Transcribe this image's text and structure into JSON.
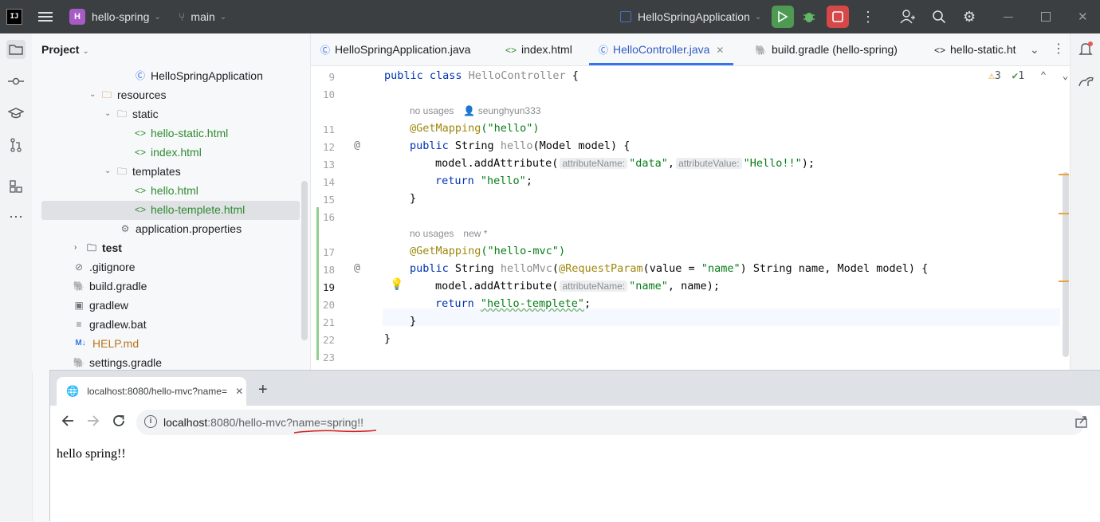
{
  "titlebar": {
    "logo": "IJ",
    "project_badge": "H",
    "project_name": "hello-spring",
    "branch": "main",
    "run_config": "HelloSpringApplication"
  },
  "project_panel": {
    "title": "Project",
    "tree": [
      {
        "label": "HelloSpringApplication",
        "icon": "class-icon",
        "color": "default"
      },
      {
        "label": "resources",
        "icon": "folder-icon",
        "color": "default"
      },
      {
        "label": "static",
        "icon": "folder-icon",
        "color": "default"
      },
      {
        "label": "hello-static.html",
        "icon": "html-icon",
        "color": "green"
      },
      {
        "label": "index.html",
        "icon": "html-icon",
        "color": "green"
      },
      {
        "label": "templates",
        "icon": "folder-icon",
        "color": "default"
      },
      {
        "label": "hello.html",
        "icon": "html-icon",
        "color": "green"
      },
      {
        "label": "hello-templete.html",
        "icon": "html-icon",
        "color": "green"
      },
      {
        "label": "application.properties",
        "icon": "gear-icon",
        "color": "default"
      },
      {
        "label": "test",
        "icon": "folder-icon",
        "color": "default"
      },
      {
        "label": ".gitignore",
        "icon": "ignore-icon",
        "color": "default"
      },
      {
        "label": "build.gradle",
        "icon": "gradle-icon",
        "color": "default"
      },
      {
        "label": "gradlew",
        "icon": "terminal-icon",
        "color": "default"
      },
      {
        "label": "gradlew.bat",
        "icon": "lines-icon",
        "color": "default"
      },
      {
        "label": "HELP.md",
        "icon": "markdown-icon",
        "color": "orange"
      },
      {
        "label": "settings.gradle",
        "icon": "gradle-icon",
        "color": "default"
      }
    ],
    "markdown_badge": "M↓"
  },
  "editor": {
    "tabs": [
      {
        "label": "HelloSpringApplication.java"
      },
      {
        "label": "index.html"
      },
      {
        "label": "HelloController.java"
      },
      {
        "label": "build.gradle (hello-spring)"
      },
      {
        "label": "hello-static.ht"
      }
    ],
    "warnings": "3",
    "checks": "1",
    "line_numbers": [
      "9",
      "10",
      "11",
      "12",
      "13",
      "14",
      "15",
      "16",
      "17",
      "18",
      "19",
      "20",
      "21",
      "22",
      "23"
    ],
    "code": {
      "l9_kw": "public class ",
      "l9_name": "HelloController",
      "l9_rest": " {",
      "usage1": "no usages",
      "author1": "seunghyun333",
      "l11_ann": "@GetMapping",
      "l11_str": "(\"hello\")",
      "l12_kw": "public ",
      "l12_type": "String ",
      "l12_name": "hello",
      "l12_rest": "(Model model) {",
      "l13_call": "model.addAttribute(",
      "hint_name": "attributeName:",
      "l13_arg1": "\"data\"",
      "l13_sep": ",",
      "hint_value": "attributeValue:",
      "l13_arg2": "\"Hello!!\"",
      "l13_end": ");",
      "l14_kw": "return ",
      "l14_str": "\"hello\"",
      "l14_end": ";",
      "close": "}",
      "usage2": "no usages",
      "author2": "new *",
      "l17_ann": "@GetMapping",
      "l17_str": "(\"hello-mvc\")",
      "l18_kw": "public ",
      "l18_type": "String ",
      "l18_name": "helloMvc",
      "l18_ann": "@RequestParam",
      "l18_a": "(value = ",
      "l18_str": "\"name\"",
      "l18_rest": ") String name, Model model) {",
      "l19_call": "model.addAttribute(",
      "l19_arg1": "\"name\"",
      "l19_rest": ", name);",
      "l20_kw": "return ",
      "l20_str": "\"hello-templete\"",
      "l20_end": ";"
    }
  },
  "browser": {
    "tab_title": "localhost:8080/hello-mvc?name=",
    "url_host": "localhost",
    "url_path": ":8080/hello-mvc?name=spring!!",
    "page_text": "hello spring!!"
  }
}
